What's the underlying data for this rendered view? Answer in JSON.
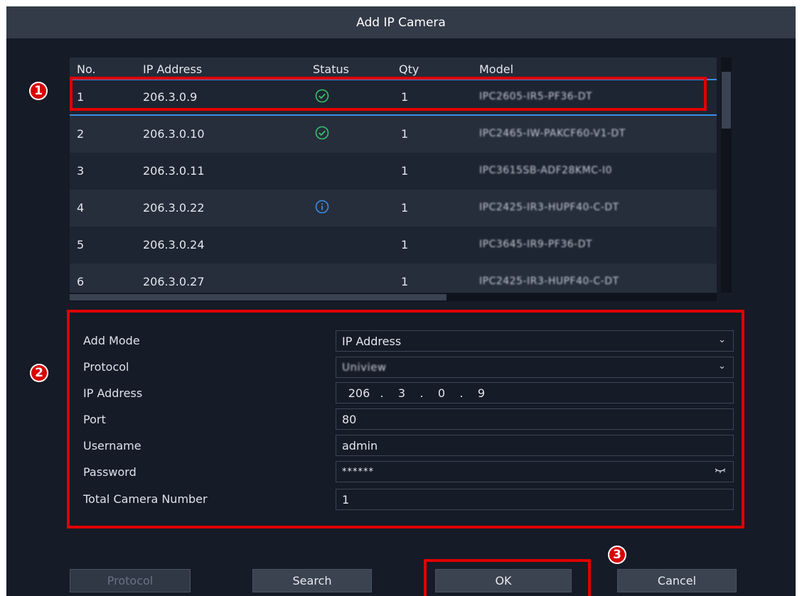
{
  "dialog": {
    "title": "Add IP Camera"
  },
  "annotations": [
    "1",
    "2",
    "3"
  ],
  "table": {
    "columns": [
      "No.",
      "IP Address",
      "Status",
      "Qty",
      "Model"
    ],
    "rows": [
      {
        "no": "1",
        "ip": "206.3.0.9",
        "status": "check",
        "qty": "1",
        "model": "IPC2605-IR5-PF36-DT"
      },
      {
        "no": "2",
        "ip": "206.3.0.10",
        "status": "check",
        "qty": "1",
        "model": "IPC2465-IW-PAKCF60-V1-DT"
      },
      {
        "no": "3",
        "ip": "206.3.0.11",
        "status": "",
        "qty": "1",
        "model": "IPC3615SB-ADF28KMC-I0"
      },
      {
        "no": "4",
        "ip": "206.3.0.22",
        "status": "info",
        "qty": "1",
        "model": "IPC2425-IR3-HUPF40-C-DT"
      },
      {
        "no": "5",
        "ip": "206.3.0.24",
        "status": "",
        "qty": "1",
        "model": "IPC3645-IR9-PF36-DT"
      },
      {
        "no": "6",
        "ip": "206.3.0.27",
        "status": "",
        "qty": "1",
        "model": "IPC2425-IR3-HUPF40-C-DT"
      }
    ]
  },
  "form": {
    "add_mode_label": "Add Mode",
    "add_mode_value": "IP Address",
    "protocol_label": "Protocol",
    "protocol_value": "Uniview",
    "ip_label": "IP Address",
    "ip": [
      "206",
      "3",
      "0",
      "9"
    ],
    "ip_dot": ".",
    "port_label": "Port",
    "port_value": "80",
    "username_label": "Username",
    "username_value": "admin",
    "password_label": "Password",
    "password_value": "******",
    "total_label": "Total Camera Number",
    "total_value": "1"
  },
  "buttons": {
    "protocol": "Protocol",
    "search": "Search",
    "ok": "OK",
    "cancel": "Cancel"
  },
  "colors": {
    "background": "#151b27",
    "titlebar": "#343b48",
    "accent": "#3a8ee6",
    "status_ok": "#36c26a",
    "status_info": "#3a8ee6",
    "highlight": "#e00000"
  }
}
